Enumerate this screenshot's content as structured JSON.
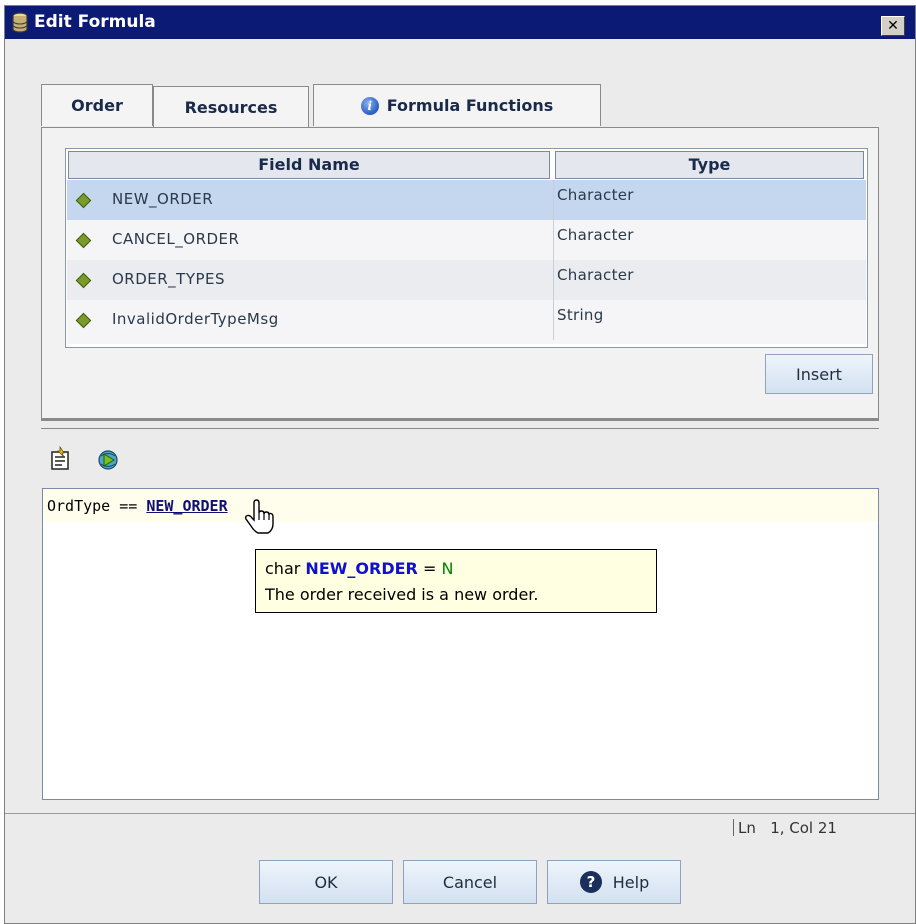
{
  "window": {
    "title": "Edit Formula",
    "close_label": "✕"
  },
  "tabs": [
    {
      "label": "Order"
    },
    {
      "label": "Resources"
    },
    {
      "label": "Formula Functions"
    }
  ],
  "table": {
    "columns": [
      "Field Name",
      "Type"
    ],
    "rows": [
      {
        "name": "NEW_ORDER",
        "type": "Character",
        "selected": true
      },
      {
        "name": "CANCEL_ORDER",
        "type": "Character"
      },
      {
        "name": "ORDER_TYPES",
        "type": "Character"
      },
      {
        "name": "InvalidOrderTypeMsg",
        "type": "String"
      }
    ]
  },
  "insert_label": "Insert",
  "toolbar": {
    "icons": [
      "insert-formula-icon",
      "debug-formula-icon"
    ]
  },
  "editor": {
    "code_prefix": "OrdType == ",
    "code_token": "NEW_ORDER"
  },
  "tooltip": {
    "type": "char",
    "name": "NEW_ORDER",
    "equals": "=",
    "value": "N",
    "description": "The order received is a new order."
  },
  "status": {
    "ln_label": "Ln",
    "ln": "1",
    "col_label": "Col",
    "col": "21"
  },
  "buttons": {
    "ok": "OK",
    "cancel": "Cancel",
    "help": "Help"
  },
  "colors": {
    "titlebar": "#0a1a75",
    "selected_row": "#c5d7ef",
    "button_face": "#d3e1f0"
  }
}
